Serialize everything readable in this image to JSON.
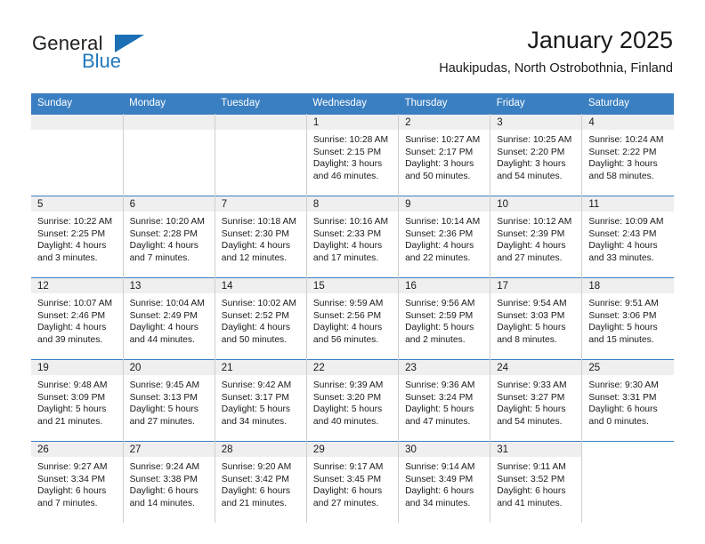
{
  "brand": {
    "name_part1": "General",
    "name_part2": "Blue",
    "triangle_icon": "triangle-icon",
    "accent_color": "#1c6fb5"
  },
  "header": {
    "title": "January 2025",
    "location": "Haukipudas, North Ostrobothnia, Finland"
  },
  "calendar": {
    "header_bg": "#3a7fc1",
    "daynum_bg": "#efefef",
    "weekdays": [
      "Sunday",
      "Monday",
      "Tuesday",
      "Wednesday",
      "Thursday",
      "Friday",
      "Saturday"
    ],
    "weeks": [
      [
        {
          "day": "",
          "empty": true
        },
        {
          "day": "",
          "empty": true
        },
        {
          "day": "",
          "empty": true
        },
        {
          "day": "1",
          "sunrise": "Sunrise: 10:28 AM",
          "sunset": "Sunset: 2:15 PM",
          "daylight_line1": "Daylight: 3 hours",
          "daylight_line2": "and 46 minutes."
        },
        {
          "day": "2",
          "sunrise": "Sunrise: 10:27 AM",
          "sunset": "Sunset: 2:17 PM",
          "daylight_line1": "Daylight: 3 hours",
          "daylight_line2": "and 50 minutes."
        },
        {
          "day": "3",
          "sunrise": "Sunrise: 10:25 AM",
          "sunset": "Sunset: 2:20 PM",
          "daylight_line1": "Daylight: 3 hours",
          "daylight_line2": "and 54 minutes."
        },
        {
          "day": "4",
          "sunrise": "Sunrise: 10:24 AM",
          "sunset": "Sunset: 2:22 PM",
          "daylight_line1": "Daylight: 3 hours",
          "daylight_line2": "and 58 minutes."
        }
      ],
      [
        {
          "day": "5",
          "sunrise": "Sunrise: 10:22 AM",
          "sunset": "Sunset: 2:25 PM",
          "daylight_line1": "Daylight: 4 hours",
          "daylight_line2": "and 3 minutes."
        },
        {
          "day": "6",
          "sunrise": "Sunrise: 10:20 AM",
          "sunset": "Sunset: 2:28 PM",
          "daylight_line1": "Daylight: 4 hours",
          "daylight_line2": "and 7 minutes."
        },
        {
          "day": "7",
          "sunrise": "Sunrise: 10:18 AM",
          "sunset": "Sunset: 2:30 PM",
          "daylight_line1": "Daylight: 4 hours",
          "daylight_line2": "and 12 minutes."
        },
        {
          "day": "8",
          "sunrise": "Sunrise: 10:16 AM",
          "sunset": "Sunset: 2:33 PM",
          "daylight_line1": "Daylight: 4 hours",
          "daylight_line2": "and 17 minutes."
        },
        {
          "day": "9",
          "sunrise": "Sunrise: 10:14 AM",
          "sunset": "Sunset: 2:36 PM",
          "daylight_line1": "Daylight: 4 hours",
          "daylight_line2": "and 22 minutes."
        },
        {
          "day": "10",
          "sunrise": "Sunrise: 10:12 AM",
          "sunset": "Sunset: 2:39 PM",
          "daylight_line1": "Daylight: 4 hours",
          "daylight_line2": "and 27 minutes."
        },
        {
          "day": "11",
          "sunrise": "Sunrise: 10:09 AM",
          "sunset": "Sunset: 2:43 PM",
          "daylight_line1": "Daylight: 4 hours",
          "daylight_line2": "and 33 minutes."
        }
      ],
      [
        {
          "day": "12",
          "sunrise": "Sunrise: 10:07 AM",
          "sunset": "Sunset: 2:46 PM",
          "daylight_line1": "Daylight: 4 hours",
          "daylight_line2": "and 39 minutes."
        },
        {
          "day": "13",
          "sunrise": "Sunrise: 10:04 AM",
          "sunset": "Sunset: 2:49 PM",
          "daylight_line1": "Daylight: 4 hours",
          "daylight_line2": "and 44 minutes."
        },
        {
          "day": "14",
          "sunrise": "Sunrise: 10:02 AM",
          "sunset": "Sunset: 2:52 PM",
          "daylight_line1": "Daylight: 4 hours",
          "daylight_line2": "and 50 minutes."
        },
        {
          "day": "15",
          "sunrise": "Sunrise: 9:59 AM",
          "sunset": "Sunset: 2:56 PM",
          "daylight_line1": "Daylight: 4 hours",
          "daylight_line2": "and 56 minutes."
        },
        {
          "day": "16",
          "sunrise": "Sunrise: 9:56 AM",
          "sunset": "Sunset: 2:59 PM",
          "daylight_line1": "Daylight: 5 hours",
          "daylight_line2": "and 2 minutes."
        },
        {
          "day": "17",
          "sunrise": "Sunrise: 9:54 AM",
          "sunset": "Sunset: 3:03 PM",
          "daylight_line1": "Daylight: 5 hours",
          "daylight_line2": "and 8 minutes."
        },
        {
          "day": "18",
          "sunrise": "Sunrise: 9:51 AM",
          "sunset": "Sunset: 3:06 PM",
          "daylight_line1": "Daylight: 5 hours",
          "daylight_line2": "and 15 minutes."
        }
      ],
      [
        {
          "day": "19",
          "sunrise": "Sunrise: 9:48 AM",
          "sunset": "Sunset: 3:09 PM",
          "daylight_line1": "Daylight: 5 hours",
          "daylight_line2": "and 21 minutes."
        },
        {
          "day": "20",
          "sunrise": "Sunrise: 9:45 AM",
          "sunset": "Sunset: 3:13 PM",
          "daylight_line1": "Daylight: 5 hours",
          "daylight_line2": "and 27 minutes."
        },
        {
          "day": "21",
          "sunrise": "Sunrise: 9:42 AM",
          "sunset": "Sunset: 3:17 PM",
          "daylight_line1": "Daylight: 5 hours",
          "daylight_line2": "and 34 minutes."
        },
        {
          "day": "22",
          "sunrise": "Sunrise: 9:39 AM",
          "sunset": "Sunset: 3:20 PM",
          "daylight_line1": "Daylight: 5 hours",
          "daylight_line2": "and 40 minutes."
        },
        {
          "day": "23",
          "sunrise": "Sunrise: 9:36 AM",
          "sunset": "Sunset: 3:24 PM",
          "daylight_line1": "Daylight: 5 hours",
          "daylight_line2": "and 47 minutes."
        },
        {
          "day": "24",
          "sunrise": "Sunrise: 9:33 AM",
          "sunset": "Sunset: 3:27 PM",
          "daylight_line1": "Daylight: 5 hours",
          "daylight_line2": "and 54 minutes."
        },
        {
          "day": "25",
          "sunrise": "Sunrise: 9:30 AM",
          "sunset": "Sunset: 3:31 PM",
          "daylight_line1": "Daylight: 6 hours",
          "daylight_line2": "and 0 minutes."
        }
      ],
      [
        {
          "day": "26",
          "sunrise": "Sunrise: 9:27 AM",
          "sunset": "Sunset: 3:34 PM",
          "daylight_line1": "Daylight: 6 hours",
          "daylight_line2": "and 7 minutes."
        },
        {
          "day": "27",
          "sunrise": "Sunrise: 9:24 AM",
          "sunset": "Sunset: 3:38 PM",
          "daylight_line1": "Daylight: 6 hours",
          "daylight_line2": "and 14 minutes."
        },
        {
          "day": "28",
          "sunrise": "Sunrise: 9:20 AM",
          "sunset": "Sunset: 3:42 PM",
          "daylight_line1": "Daylight: 6 hours",
          "daylight_line2": "and 21 minutes."
        },
        {
          "day": "29",
          "sunrise": "Sunrise: 9:17 AM",
          "sunset": "Sunset: 3:45 PM",
          "daylight_line1": "Daylight: 6 hours",
          "daylight_line2": "and 27 minutes."
        },
        {
          "day": "30",
          "sunrise": "Sunrise: 9:14 AM",
          "sunset": "Sunset: 3:49 PM",
          "daylight_line1": "Daylight: 6 hours",
          "daylight_line2": "and 34 minutes."
        },
        {
          "day": "31",
          "sunrise": "Sunrise: 9:11 AM",
          "sunset": "Sunset: 3:52 PM",
          "daylight_line1": "Daylight: 6 hours",
          "daylight_line2": "and 41 minutes."
        },
        {
          "day": "",
          "empty": true,
          "no_band": true
        }
      ]
    ]
  }
}
